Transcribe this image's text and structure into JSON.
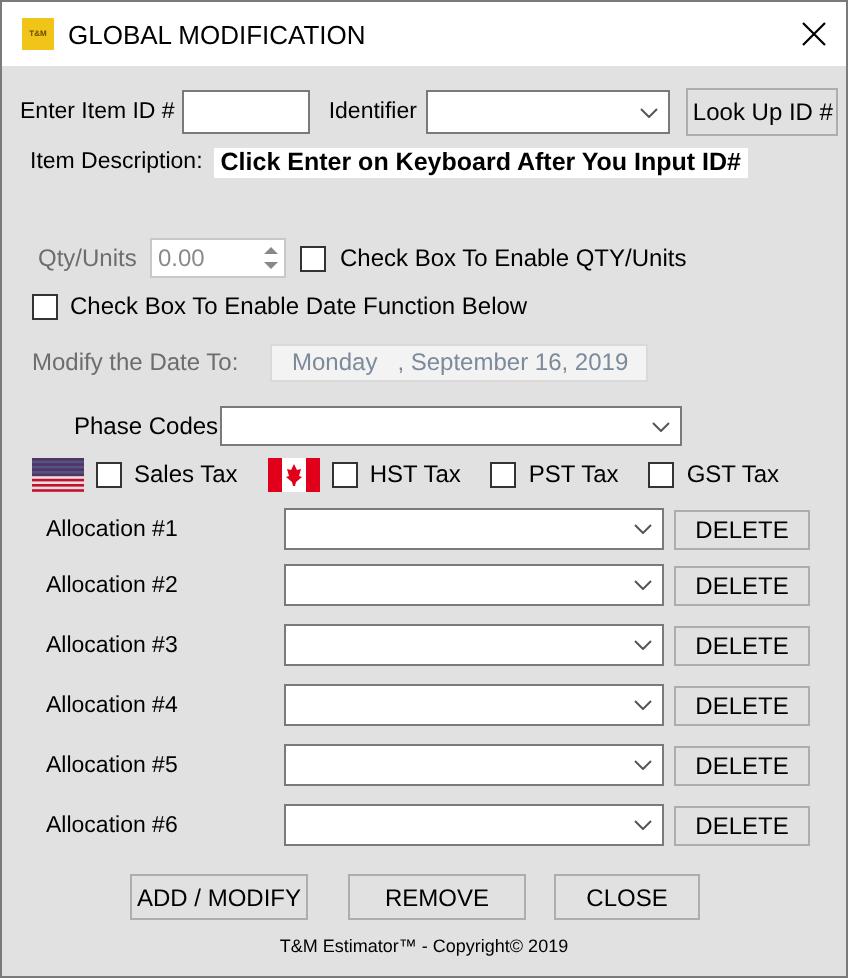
{
  "window": {
    "logo_text": "T&M",
    "title": "GLOBAL MODIFICATION"
  },
  "item_id": {
    "label": "Enter Item ID #"
  },
  "identifier": {
    "label": "Identifier"
  },
  "lookup_button": "Look Up ID #",
  "item_description": {
    "label": "Item Description:",
    "value": "Click Enter on Keyboard After You Input ID#"
  },
  "qty": {
    "label": "Qty/Units",
    "value": "0.00",
    "disabled": true
  },
  "qty_checkbox": {
    "label": "Check Box To Enable QTY/Units",
    "checked": false
  },
  "date_checkbox": {
    "label": "Check Box To Enable Date Function Below",
    "checked": false
  },
  "date": {
    "label": "Modify the Date To:",
    "weekday": "Monday",
    "date": ", September 16, 2019",
    "disabled": true
  },
  "phase_codes": {
    "label": "Phase Codes"
  },
  "taxes": [
    {
      "kind": "us",
      "label": "Sales Tax",
      "checked": false
    },
    {
      "kind": "ca",
      "label": "HST Tax",
      "checked": false
    },
    {
      "kind": "plain",
      "label": "PST Tax",
      "checked": false
    },
    {
      "kind": "plain",
      "label": "GST Tax",
      "checked": false
    }
  ],
  "allocations": [
    {
      "label": "Allocation #1",
      "button": "DELETE"
    },
    {
      "label": "Allocation #2",
      "button": "DELETE"
    },
    {
      "label": "Allocation #3",
      "button": "DELETE"
    },
    {
      "label": "Allocation #4",
      "button": "DELETE"
    },
    {
      "label": "Allocation #5",
      "button": "DELETE"
    },
    {
      "label": "Allocation #6",
      "button": "DELETE"
    }
  ],
  "buttons": [
    "ADD / MODIFY",
    "REMOVE",
    "CLOSE"
  ],
  "footer": "T&M Estimator™ - Copyright© 2019"
}
